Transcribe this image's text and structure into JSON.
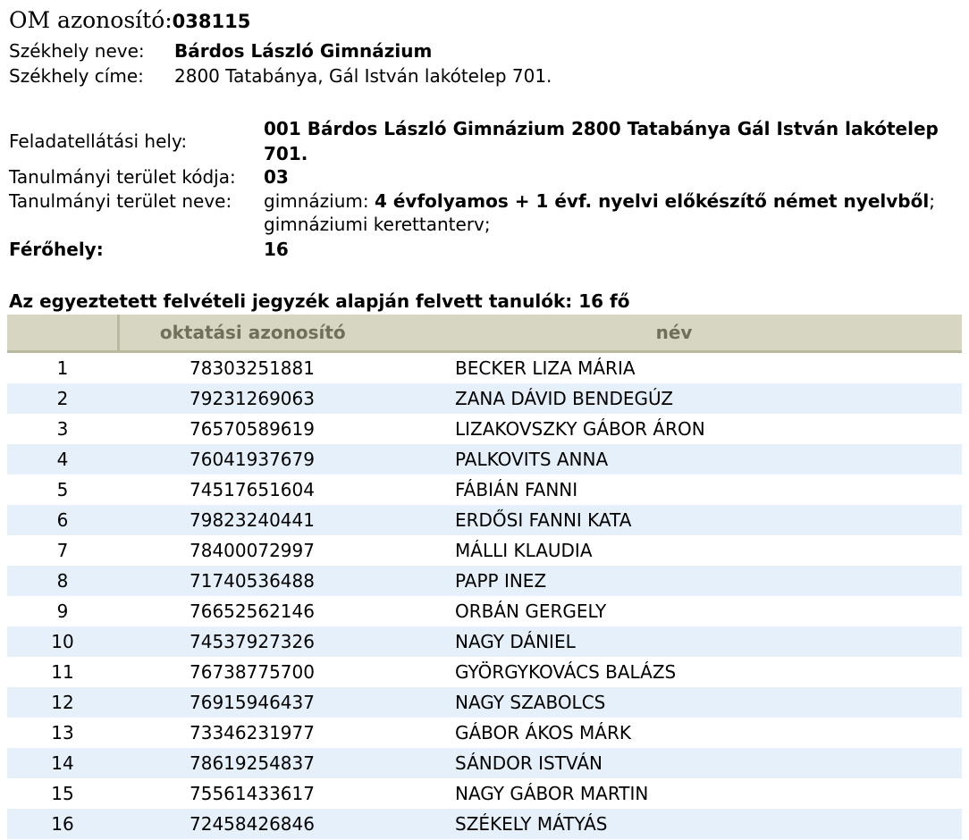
{
  "om": {
    "label": "OM azonosító:",
    "value": "038115"
  },
  "seat": {
    "name_label": "Székhely neve:",
    "name_value": "Bárdos László Gimnázium",
    "address_label": "Székhely címe:",
    "address_value": "2800 Tatabánya, Gál István lakótelep 701."
  },
  "task": {
    "label": "Feladatellátási hely:",
    "value": "001  Bárdos László Gimnázium  2800  Tatabánya  Gál István lakótelep 701."
  },
  "study_area": {
    "code_label": "Tanulmányi terület kódja:",
    "code_value": "03",
    "name_label": "Tanulmányi terület neve:",
    "name_prefix": "gimnázium: ",
    "name_bold": "4 évfolyamos + 1 évf. nyelvi előkészítő német nyelvből",
    "name_suffix": "; gimnáziumi kerettanterv;"
  },
  "capacity": {
    "label": "Férőhely:",
    "value": "16"
  },
  "list": {
    "heading": "Az egyeztetett felvételi jegyzék alapján felvett tanulók: 16 fő",
    "columns": [
      "",
      "oktatási azonosító",
      "név"
    ],
    "rows": [
      {
        "n": "1",
        "id": "78303251881",
        "name": "BECKER LIZA MÁRIA"
      },
      {
        "n": "2",
        "id": "79231269063",
        "name": "ZANA DÁVID BENDEGÚZ"
      },
      {
        "n": "3",
        "id": "76570589619",
        "name": "LIZAKOVSZKY GÁBOR ÁRON"
      },
      {
        "n": "4",
        "id": "76041937679",
        "name": "PALKOVITS ANNA"
      },
      {
        "n": "5",
        "id": "74517651604",
        "name": "FÁBIÁN FANNI"
      },
      {
        "n": "6",
        "id": "79823240441",
        "name": "ERDŐSI FANNI KATA"
      },
      {
        "n": "7",
        "id": "78400072997",
        "name": "MÁLLI KLAUDIA"
      },
      {
        "n": "8",
        "id": "71740536488",
        "name": "PAPP INEZ"
      },
      {
        "n": "9",
        "id": "76652562146",
        "name": "ORBÁN GERGELY"
      },
      {
        "n": "10",
        "id": "74537927326",
        "name": "NAGY DÁNIEL"
      },
      {
        "n": "11",
        "id": "76738775700",
        "name": "GYÖRGYKOVÁCS BALÁZS"
      },
      {
        "n": "12",
        "id": "76915946437",
        "name": "NAGY SZABOLCS"
      },
      {
        "n": "13",
        "id": "73346231977",
        "name": "GÁBOR ÁKOS MÁRK"
      },
      {
        "n": "14",
        "id": "78619254837",
        "name": "SÁNDOR ISTVÁN"
      },
      {
        "n": "15",
        "id": "75561433617",
        "name": "NAGY GÁBOR MARTIN"
      },
      {
        "n": "16",
        "id": "72458426846",
        "name": "SZÉKELY MÁTYÁS"
      }
    ]
  },
  "colors": {
    "header_bg": "#d6d6c2",
    "header_text": "#6f6f5a",
    "stripe_bg": "#e6f0fa"
  }
}
